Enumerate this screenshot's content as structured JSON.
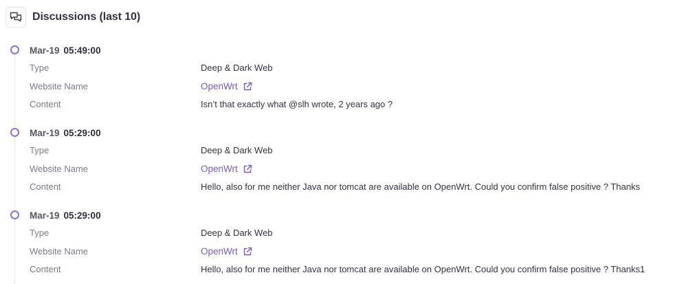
{
  "header": {
    "title": "Discussions (last 10)",
    "icon": "chat-bubbles-icon"
  },
  "colors": {
    "accent": "#7a56d8",
    "timeline_dot": "#8b6fe0",
    "label": "#7c7c88"
  },
  "labels": {
    "type": "Type",
    "website_name": "Website Name",
    "content": "Content"
  },
  "entries": [
    {
      "date": "Mar-19",
      "time": "05:49:00",
      "type": "Deep & Dark Web",
      "website_name": "OpenWrt",
      "content": "Isn’t that exactly what @slh wrote, 2 years ago ?"
    },
    {
      "date": "Mar-19",
      "time": "05:29:00",
      "type": "Deep & Dark Web",
      "website_name": "OpenWrt",
      "content": "Hello, also for me neither Java nor tomcat are available on OpenWrt. Could you confirm false positive ? Thanks"
    },
    {
      "date": "Mar-19",
      "time": "05:29:00",
      "type": "Deep & Dark Web",
      "website_name": "OpenWrt",
      "content": "Hello, also for me neither Java nor tomcat are available on OpenWrt. Could you confirm false positive ? Thanks1"
    }
  ]
}
